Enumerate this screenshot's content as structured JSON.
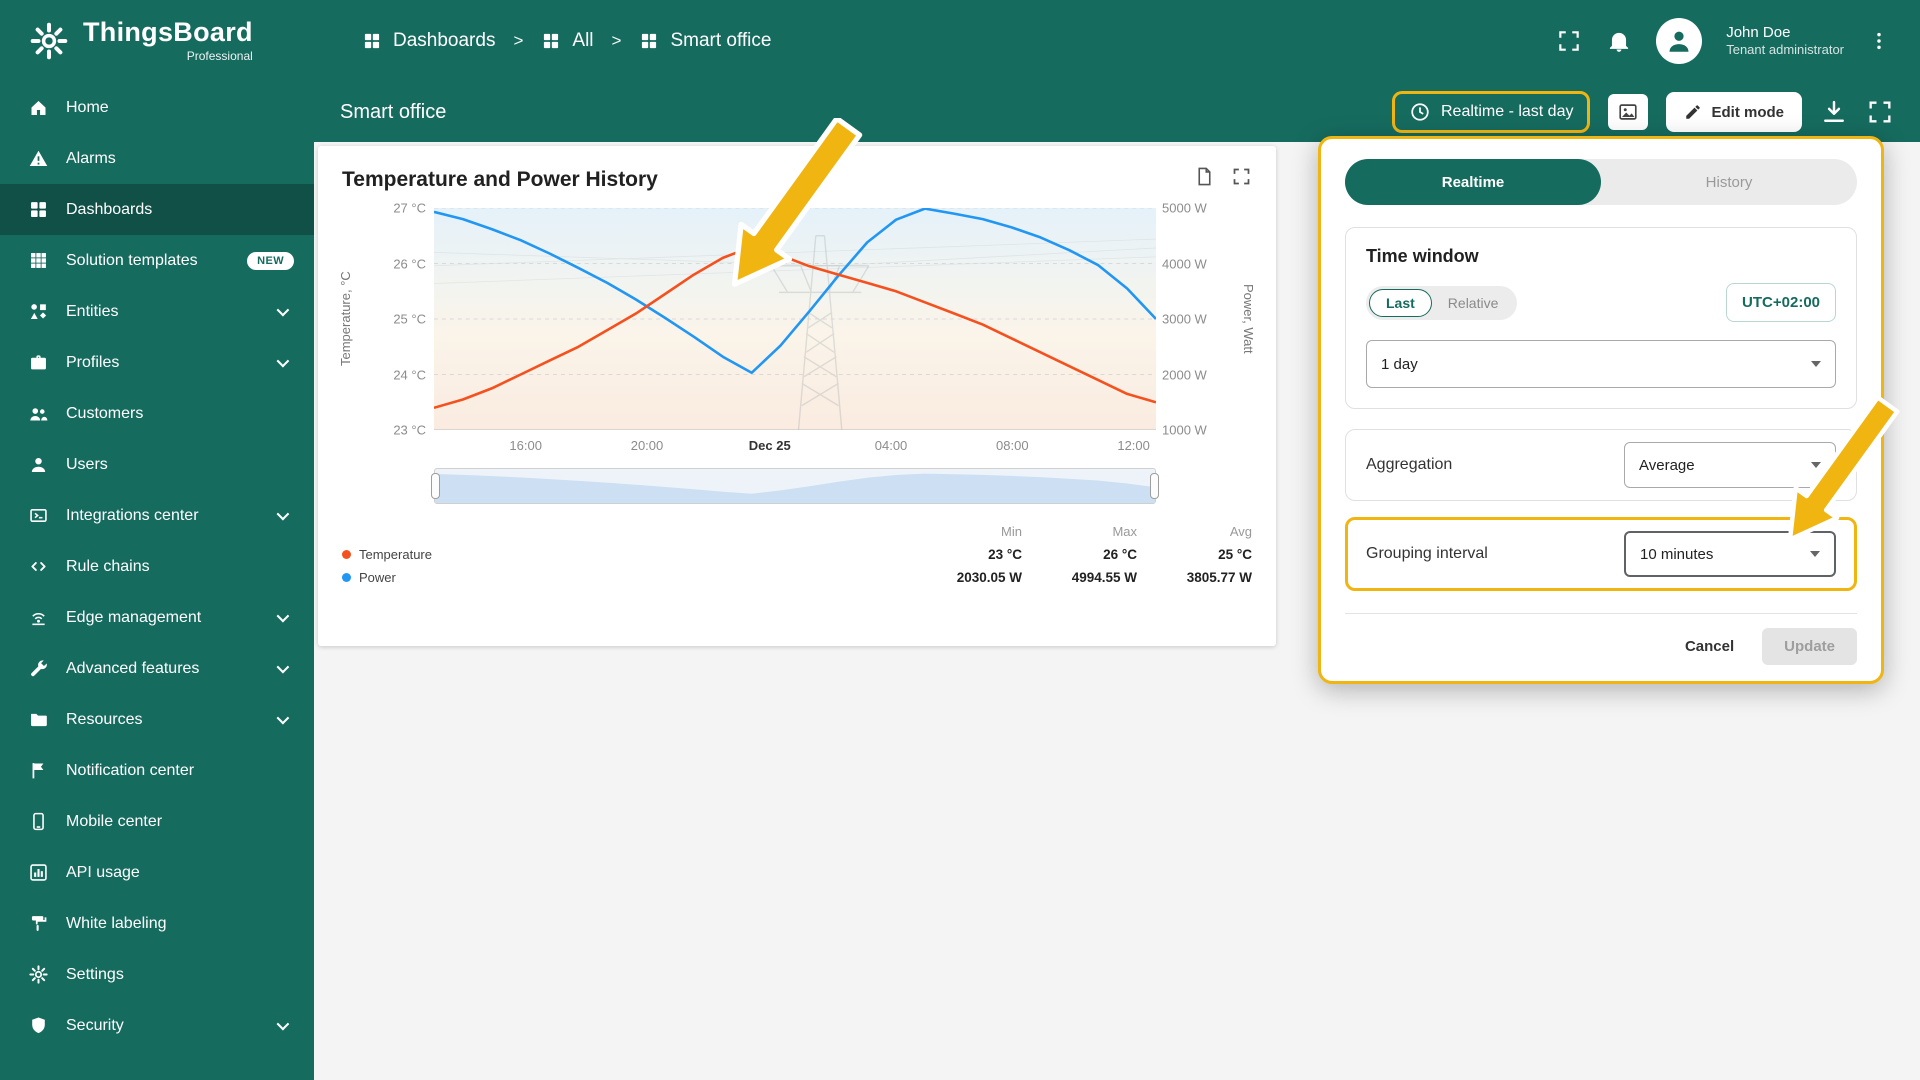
{
  "header": {
    "logo_title": "ThingsBoard",
    "logo_subtitle": "Professional",
    "breadcrumb": [
      "Dashboards",
      "All",
      "Smart office"
    ],
    "breadcrumb_separator": ">",
    "user_name": "John Doe",
    "user_role": "Tenant administrator"
  },
  "sidebar": {
    "items": [
      {
        "label": "Home"
      },
      {
        "label": "Alarms"
      },
      {
        "label": "Dashboards",
        "active": true
      },
      {
        "label": "Solution templates",
        "badge": "NEW"
      },
      {
        "label": "Entities",
        "expandable": true
      },
      {
        "label": "Profiles",
        "expandable": true
      },
      {
        "label": "Customers"
      },
      {
        "label": "Users"
      },
      {
        "label": "Integrations center",
        "expandable": true
      },
      {
        "label": "Rule chains"
      },
      {
        "label": "Edge management",
        "expandable": true
      },
      {
        "label": "Advanced features",
        "expandable": true
      },
      {
        "label": "Resources",
        "expandable": true
      },
      {
        "label": "Notification center"
      },
      {
        "label": "Mobile center"
      },
      {
        "label": "API usage"
      },
      {
        "label": "White labeling"
      },
      {
        "label": "Settings"
      },
      {
        "label": "Security",
        "expandable": true
      }
    ]
  },
  "toolbar": {
    "page_title": "Smart office",
    "timewindow_label": "Realtime - last day",
    "edit_mode_label": "Edit mode"
  },
  "widget": {
    "title": "Temperature and Power History",
    "legend_headers": [
      "Min",
      "Max",
      "Avg"
    ],
    "legend_rows": [
      {
        "label": "Temperature",
        "color": "#f4511e",
        "min": "23 °C",
        "max": "26 °C",
        "avg": "25 °C"
      },
      {
        "label": "Power",
        "color": "#2196f3",
        "min": "2030.05 W",
        "max": "4994.55 W",
        "avg": "3805.77 W"
      }
    ]
  },
  "chart_data": {
    "type": "line",
    "title": "Temperature and Power History",
    "x_ticks": [
      "16:00",
      "20:00",
      "Dec 25",
      "04:00",
      "08:00",
      "12:00"
    ],
    "x_emphasis_index": 2,
    "x_tick_fractions": [
      0.127,
      0.295,
      0.465,
      0.633,
      0.801,
      0.969
    ],
    "y_left": {
      "label": "Temperature, °C",
      "min": 23,
      "max": 27,
      "ticks": [
        "23 °C",
        "24 °C",
        "25 °C",
        "26 °C",
        "27 °C"
      ]
    },
    "y_right": {
      "label": "Power, Watt",
      "min": 1000,
      "max": 5000,
      "ticks": [
        "1000 W",
        "2000 W",
        "3000 W",
        "4000 W",
        "5000 W"
      ]
    },
    "grid": true,
    "legend_position": "bottom",
    "series": [
      {
        "name": "Temperature",
        "axis": "left",
        "color": "#f4511e",
        "values": [
          23.4,
          23.55,
          23.75,
          24.0,
          24.25,
          24.5,
          24.8,
          25.1,
          25.45,
          25.8,
          26.1,
          26.3,
          26.15,
          25.95,
          25.8,
          25.65,
          25.5,
          25.3,
          25.1,
          24.9,
          24.65,
          24.4,
          24.15,
          23.9,
          23.65,
          23.5
        ],
        "stats": {
          "min": "23 °C",
          "max": "26 °C",
          "avg": "25 °C"
        }
      },
      {
        "name": "Power",
        "axis": "right",
        "color": "#2196f3",
        "values": [
          4930,
          4800,
          4620,
          4420,
          4180,
          3920,
          3650,
          3350,
          3020,
          2680,
          2320,
          2030,
          2520,
          3140,
          3780,
          4380,
          4790,
          4990,
          4900,
          4800,
          4650,
          4470,
          4240,
          3970,
          3550,
          3000
        ],
        "stats": {
          "min": "2030.05 W",
          "max": "4994.55 W",
          "avg": "3805.77 W"
        }
      }
    ]
  },
  "panel": {
    "tabs": [
      {
        "label": "Realtime",
        "active": true
      },
      {
        "label": "History",
        "active": false
      }
    ],
    "time_window_title": "Time window",
    "last_label": "Last",
    "relative_label": "Relative",
    "timezone": "UTC+02:00",
    "interval_value": "1 day",
    "aggregation_label": "Aggregation",
    "aggregation_value": "Average",
    "grouping_label": "Grouping interval",
    "grouping_value": "10 minutes",
    "cancel_label": "Cancel",
    "update_label": "Update"
  },
  "colors": {
    "primary": "#166b5f",
    "highlight": "#f0b511",
    "temperature_series": "#f4511e",
    "power_series": "#2196f3"
  }
}
